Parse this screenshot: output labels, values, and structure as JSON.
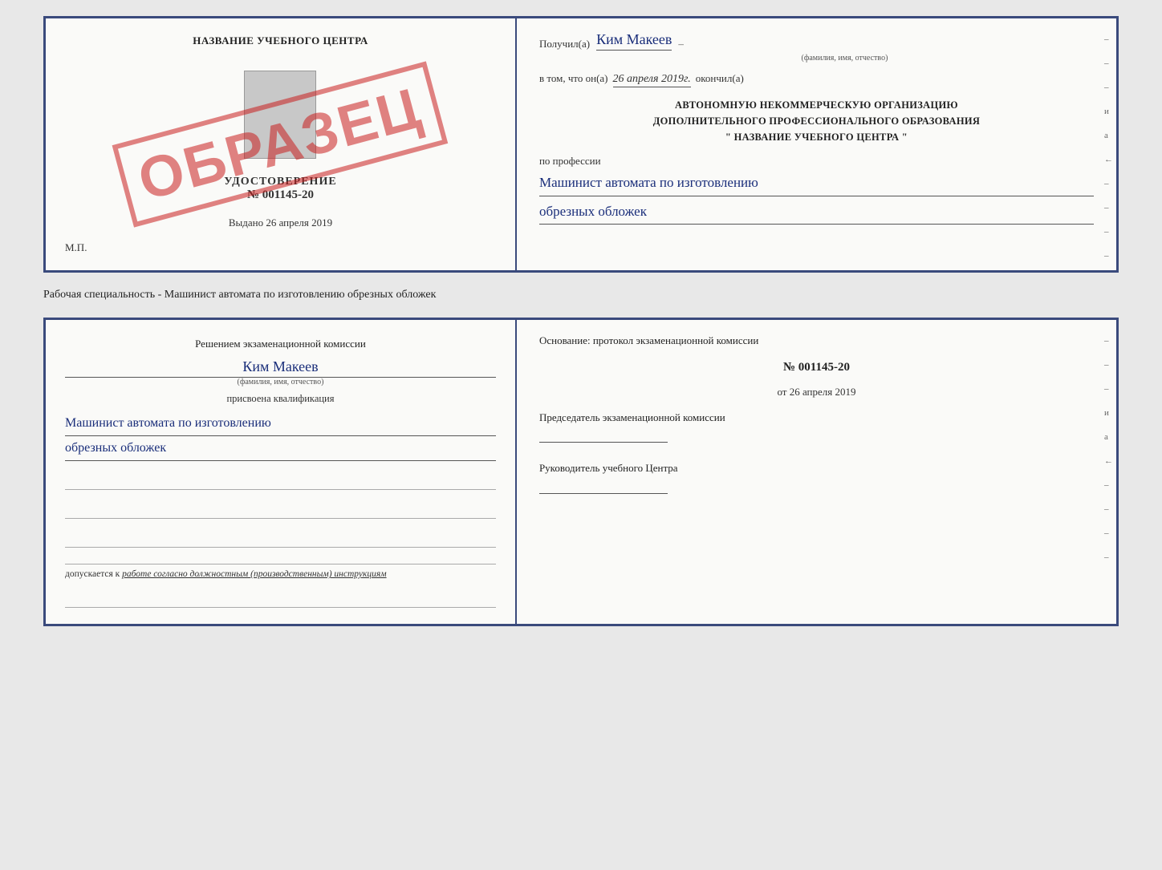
{
  "page": {
    "background": "#e8e8e8"
  },
  "top_certificate": {
    "left": {
      "school_name": "НАЗВАНИЕ УЧЕБНОГО ЦЕНТРА",
      "stamp_text": "ОБРАЗЕЦ",
      "udost_title": "УДОСТОВЕРЕНИЕ",
      "udost_number": "№ 001145-20",
      "vydano_label": "Выдано",
      "vydano_date": "26 апреля 2019",
      "mp_label": "М.П."
    },
    "right": {
      "poluchil_label": "Получил(а)",
      "name_handwritten": "Ким Макеев",
      "name_hint": "(фамилия, имя, отчество)",
      "vtom_label": "в том, что он(а)",
      "date_handwritten": "26 апреля 2019г.",
      "okonchil_label": "окончил(а)",
      "org_line1": "АВТОНОМНУЮ НЕКОММЕРЧЕСКУЮ ОРГАНИЗАЦИЮ",
      "org_line2": "ДОПОЛНИТЕЛЬНОГО ПРОФЕССИОНАЛЬНОГО ОБРАЗОВАНИЯ",
      "org_line3": "\"  НАЗВАНИЕ УЧЕБНОГО ЦЕНТРА  \"",
      "po_professii_label": "по профессии",
      "profession_line1": "Машинист автомата по изготовлению",
      "profession_line2": "обрезных обложек",
      "edge_marks": [
        "-",
        "-",
        "-",
        "и",
        "а",
        "←",
        "-",
        "-",
        "-",
        "-"
      ]
    }
  },
  "between_label": "Рабочая специальность - Машинист автомата по изготовлению обрезных обложек",
  "bottom_certificate": {
    "left": {
      "resheniem_text": "Решением экзаменационной комиссии",
      "name_handwritten": "Ким Макеев",
      "name_hint": "(фамилия, имя, отчество)",
      "prisvoena_label": "присвоена квалификация",
      "qualification_line1": "Машинист автомата по изготовлению",
      "qualification_line2": "обрезных обложек",
      "blank_lines_count": 3,
      "dopusk_label": "допускается к",
      "dopusk_italic": "работе согласно должностным (производственным) инструкциям"
    },
    "right": {
      "osnovaniye_label": "Основание: протокол экзаменационной комиссии",
      "protocol_number": "№ 001145-20",
      "ot_label": "от",
      "ot_date": "26 апреля 2019",
      "predsedatel_label": "Председатель экзаменационной комиссии",
      "rukovoditel_label": "Руководитель учебного Центра",
      "edge_marks": [
        "-",
        "-",
        "-",
        "и",
        "а",
        "←",
        "-",
        "-",
        "-",
        "-"
      ]
    }
  }
}
